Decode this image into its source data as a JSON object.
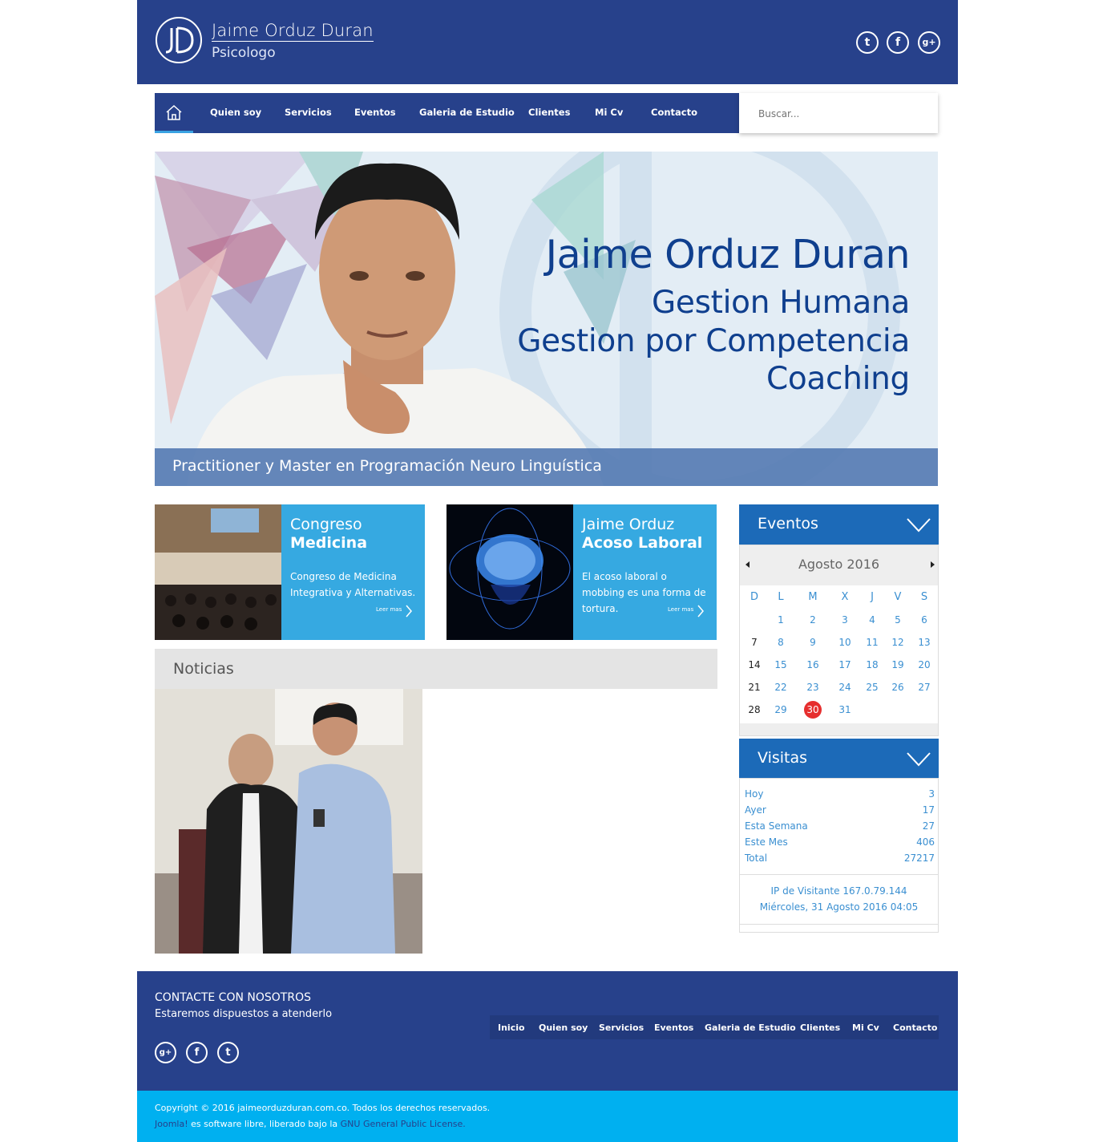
{
  "header": {
    "logo_text": "JD",
    "name": "Jaime Orduz Duran",
    "subtitle": "Psicologo",
    "social": [
      {
        "icon": "twitter-icon",
        "glyph": "t"
      },
      {
        "icon": "facebook-icon",
        "glyph": "f"
      },
      {
        "icon": "google-plus-icon",
        "glyph": "g+"
      }
    ]
  },
  "nav": {
    "home_icon": "home-icon",
    "items": [
      "Quien soy",
      "Servicios",
      "Eventos",
      "Galeria de Estudio",
      "Clientes",
      "Mi Cv",
      "Contacto"
    ],
    "search_placeholder": "Buscar..."
  },
  "hero": {
    "name": "Jaime Orduz Duran",
    "lines": [
      "Gestion Humana",
      "Gestion por Competencia",
      "Coaching"
    ],
    "caption": "Practitioner y Master en Programación Neuro Linguística"
  },
  "cards": [
    {
      "title": "Congreso",
      "title_bold": "Medicina",
      "desc": "Congreso de Medicina Integrativa y Alternativas.",
      "more": "Leer mas"
    },
    {
      "title": "Jaime Orduz",
      "title_bold": "Acoso Laboral",
      "desc": "El acoso laboral o mobbing es una forma de tortura.",
      "more": "Leer mas"
    }
  ],
  "news": {
    "title": "Noticias"
  },
  "events": {
    "title": "Eventos",
    "month": "Agosto 2016",
    "weekdays": [
      "D",
      "L",
      "M",
      "X",
      "J",
      "V",
      "S"
    ],
    "weeks": [
      [
        "",
        "1",
        "2",
        "3",
        "4",
        "5",
        "6"
      ],
      [
        "7",
        "8",
        "9",
        "10",
        "11",
        "12",
        "13"
      ],
      [
        "14",
        "15",
        "16",
        "17",
        "18",
        "19",
        "20"
      ],
      [
        "21",
        "22",
        "23",
        "24",
        "25",
        "26",
        "27"
      ],
      [
        "28",
        "29",
        "30",
        "31",
        "",
        "",
        ""
      ]
    ],
    "today": "30"
  },
  "visits": {
    "title": "Visitas",
    "rows": [
      {
        "label": "Hoy",
        "value": "3"
      },
      {
        "label": "Ayer",
        "value": "17"
      },
      {
        "label": "Esta Semana",
        "value": "27"
      },
      {
        "label": "Este Mes",
        "value": "406"
      },
      {
        "label": "Total",
        "value": "27217"
      }
    ],
    "ip": "IP de Visitante 167.0.79.144",
    "date": "Miércoles, 31 Agosto 2016 04:05"
  },
  "footer": {
    "title": "CONTACTE CON NOSOTROS",
    "subtitle": "Estaremos dispuestos a atenderlo",
    "social": [
      {
        "icon": "google-plus-icon",
        "glyph": "g+"
      },
      {
        "icon": "facebook-icon",
        "glyph": "f"
      },
      {
        "icon": "twitter-icon",
        "glyph": "t"
      }
    ],
    "links": [
      "Inicio",
      "Quien soy",
      "Servicios",
      "Eventos",
      "Galeria de Estudio",
      "Clientes",
      "Mi Cv",
      "Contacto"
    ],
    "copyright": "Copyright © 2016 jaimeorduzduran.com.co. Todos los derechos reservados.",
    "joomla_prefix": "Joomla!",
    "joomla_mid": " es software libre, liberado bajo la ",
    "joomla_license": "GNU General Public License."
  },
  "colors": {
    "header_blue": "#27418b",
    "accent_blue": "#36a9e1",
    "widget_blue": "#1c6ab8",
    "footer_bar": "#00b0f0",
    "today_red": "#e62e2e"
  }
}
